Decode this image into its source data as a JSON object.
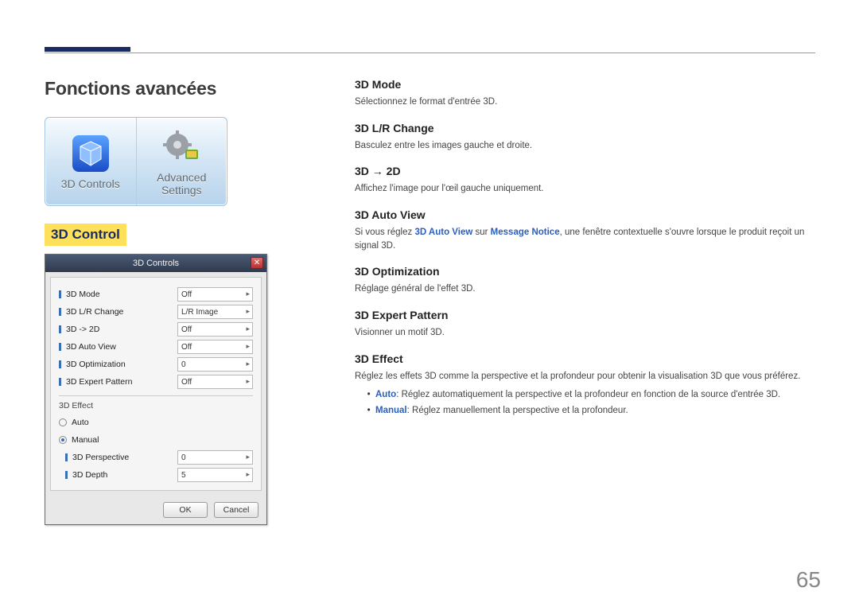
{
  "page_number": "65",
  "title": "Fonctions avancées",
  "icons": {
    "controls_label": "3D Controls",
    "advanced_label_l1": "Advanced",
    "advanced_label_l2": "Settings"
  },
  "section_heading": "3D Control",
  "dialog": {
    "title": "3D Controls",
    "rows": [
      {
        "label": "3D Mode",
        "value": "Off"
      },
      {
        "label": "3D L/R Change",
        "value": "L/R Image"
      },
      {
        "label": "3D -> 2D",
        "value": "Off"
      },
      {
        "label": "3D Auto View",
        "value": "Off"
      },
      {
        "label": "3D Optimization",
        "value": "0"
      },
      {
        "label": "3D Expert Pattern",
        "value": "Off"
      }
    ],
    "group_label": "3D Effect",
    "radios": [
      {
        "label": "Auto",
        "selected": false
      },
      {
        "label": "Manual",
        "selected": true
      }
    ],
    "subrows": [
      {
        "label": "3D Perspective",
        "value": "0"
      },
      {
        "label": "3D Depth",
        "value": "5"
      }
    ],
    "ok": "OK",
    "cancel": "Cancel"
  },
  "options": [
    {
      "heading": "3D Mode",
      "desc": "Sélectionnez le format d'entrée 3D."
    },
    {
      "heading": "3D L/R Change",
      "desc": "Basculez entre les images gauche et droite."
    },
    {
      "heading": "3D → 2D",
      "desc": "Affichez l'image pour l'œil gauche uniquement."
    },
    {
      "heading": "3D Auto View",
      "desc_html": "Si vous réglez <span class='kw'>3D Auto View</span> sur <span class='kw'>Message Notice</span>, une fenêtre contextuelle s'ouvre lorsque le produit reçoit un signal 3D."
    },
    {
      "heading": "3D Optimization",
      "desc": "Réglage général de l'effet 3D."
    },
    {
      "heading": "3D Expert Pattern",
      "desc": "Visionner un motif 3D."
    },
    {
      "heading": "3D Effect",
      "desc": "Réglez les effets 3D comme la perspective et la profondeur pour obtenir la visualisation 3D que vous préférez.",
      "bullets": [
        {
          "kw": "Auto",
          "text": ": Réglez automatiquement la perspective et la profondeur en fonction de la source d'entrée 3D."
        },
        {
          "kw": "Manual",
          "text": ": Réglez manuellement la perspective et la profondeur."
        }
      ]
    }
  ]
}
